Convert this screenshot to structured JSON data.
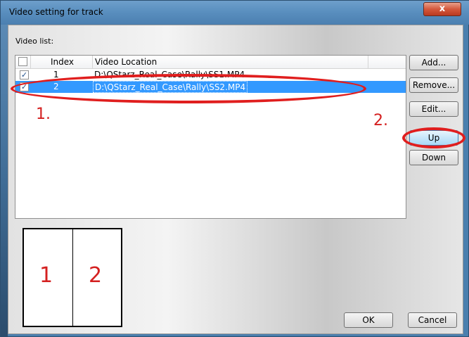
{
  "window": {
    "title": "Video setting for track",
    "close_label": "x"
  },
  "video_list": {
    "label": "Video list:",
    "columns": [
      "Index",
      "Video Location"
    ],
    "rows": [
      {
        "checked": true,
        "index": "1",
        "location": "D:\\QStarz_Real_Case\\Rally\\SS1.MP4",
        "selected": false
      },
      {
        "checked": true,
        "index": "2",
        "location": "D:\\QStarz_Real_Case\\Rally\\SS2.MP4",
        "selected": true
      }
    ]
  },
  "buttons": {
    "add": "Add...",
    "remove": "Remove...",
    "edit": "Edit...",
    "up": "Up",
    "down": "Down",
    "ok": "OK",
    "cancel": "Cancel"
  },
  "annotations": {
    "step1": "1.",
    "step2": "2.",
    "color": "#d42020"
  },
  "preview": {
    "panel1": "1",
    "panel2": "2"
  },
  "colors": {
    "selection": "#3399ff",
    "title_bar": "#5a8fbf",
    "close_button": "#d4583c"
  }
}
